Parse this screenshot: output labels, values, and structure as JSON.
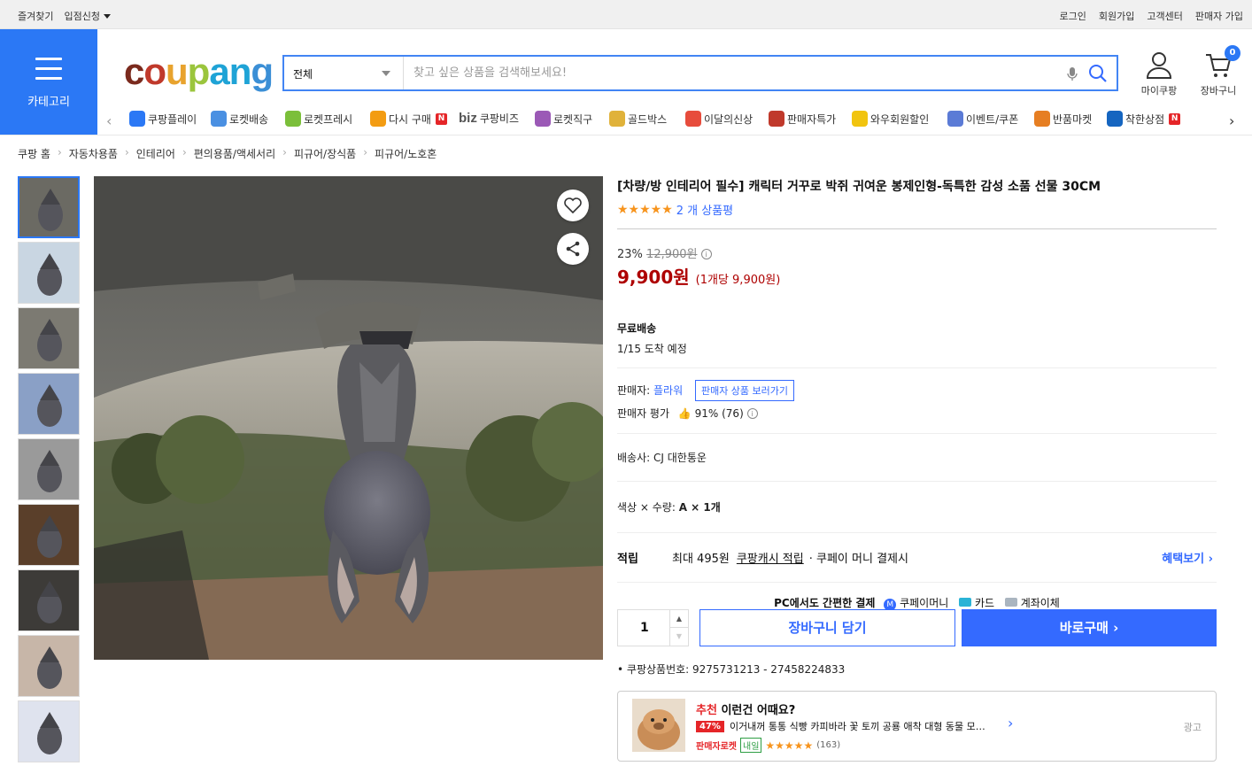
{
  "topbar": {
    "left": [
      "즐겨찾기",
      "입점신청"
    ],
    "right": [
      "로그인",
      "회원가입",
      "고객센터",
      "판매자 가입"
    ]
  },
  "category_label": "카테고리",
  "logo": {
    "letters": [
      "c",
      "o",
      "u",
      "p",
      "a",
      "n",
      "g"
    ],
    "colors": [
      "#7a2a1d",
      "#c0392b",
      "#e8a32e",
      "#9bc53d",
      "#1fa3d6",
      "#1fa3d6",
      "#3b8fd6"
    ]
  },
  "search": {
    "category": "전체",
    "placeholder": "찾고 싶은 상품을 검색해보세요!"
  },
  "header_icons": {
    "mycoupang": "마이쿠팡",
    "cart": "장바구니",
    "cart_count": "0"
  },
  "menu": [
    {
      "label": "쿠팡플레이",
      "icon": "play-icon",
      "color": "#2b78f5"
    },
    {
      "label": "로켓배송",
      "icon": "rocket-icon",
      "color": "#4a90e2"
    },
    {
      "label": "로켓프레시",
      "icon": "fresh-rocket-icon",
      "color": "#7bbf3a"
    },
    {
      "label": "다시 구매",
      "icon": "basket-icon",
      "color": "#f39c12",
      "badge": "N"
    },
    {
      "label": "쿠팡비즈",
      "icon": "biz-icon",
      "color": "#555",
      "prefix": "biz"
    },
    {
      "label": "로켓직구",
      "icon": "global-rocket-icon",
      "color": "#9b59b6"
    },
    {
      "label": "골드박스",
      "icon": "goldbox-icon",
      "color": "#e0b23a"
    },
    {
      "label": "이달의신상",
      "icon": "new-bag-icon",
      "color": "#e74c3c"
    },
    {
      "label": "판매자특가",
      "icon": "percent-icon",
      "color": "#c0392b"
    },
    {
      "label": "와우회원할인",
      "icon": "wow-icon",
      "color": "#f1c40f"
    },
    {
      "label": "이벤트/쿠폰",
      "icon": "coupon-icon",
      "color": "#5b7bd6"
    },
    {
      "label": "반품마켓",
      "icon": "market-icon",
      "color": "#e67e22"
    },
    {
      "label": "착한상점",
      "icon": "shop-icon",
      "color": "#1565c0",
      "badge": "N"
    }
  ],
  "breadcrumb": [
    "쿠팡 홈",
    "자동차용품",
    "인테리어",
    "편의용품/액세서리",
    "피규어/장식품",
    "피규어/노호혼"
  ],
  "product": {
    "title": "[차량/방 인테리어 필수] 캐릭터 거꾸로 박쥐 귀여운 봉제인형-독특한 감성 소품 선물 30CM",
    "stars": "★★★★★",
    "rating": 5,
    "review_text": "2 개 상품평",
    "discount_rate": "23%",
    "original_price": "12,900원",
    "price": "9,900원",
    "unit_price": "(1개당 9,900원)",
    "shipping_title": "무료배송",
    "arrival": "1/15 도착 예정",
    "seller_label": "판매자:",
    "seller_name": "플라워",
    "seller_button": "판매자 상품 보러가기",
    "seller_rating_label": "판매자 평가",
    "seller_rating": "91% (76)",
    "carrier_label": "배송사:",
    "carrier": "CJ 대한통운",
    "option_label": "색상 × 수량:",
    "option_value": "A × 1개",
    "points_label": "적립",
    "points_max": "최대 495원",
    "points_cash": "쿠팡캐시 적립",
    "points_pay": "· 쿠페이 머니 결제시",
    "benefit": "혜택보기",
    "pc_pay": "PC에서도 간편한 결제",
    "pay_methods": [
      "쿠페이머니",
      "카드",
      "계좌이체"
    ],
    "quantity": "1",
    "cart_button": "장바구니 담기",
    "buy_button": "바로구매",
    "product_no": "쿠팡상품번호: 9275731213 - 27458224833"
  },
  "recommend": {
    "label_red": "추천",
    "label": "이런건 어때요?",
    "discount": "47%",
    "name": "이거내꺼 통통 식빵 카피바라 꽃 토끼 공룡 애착 대형 동물 모…",
    "tag": "판매자로켓",
    "tag2": "내일",
    "stars": "★★★★★",
    "count": "(163)",
    "ad": "광고"
  },
  "colors": {
    "accent": "#346aff",
    "category_bg": "#2b78f5",
    "price": "#ae0000"
  }
}
